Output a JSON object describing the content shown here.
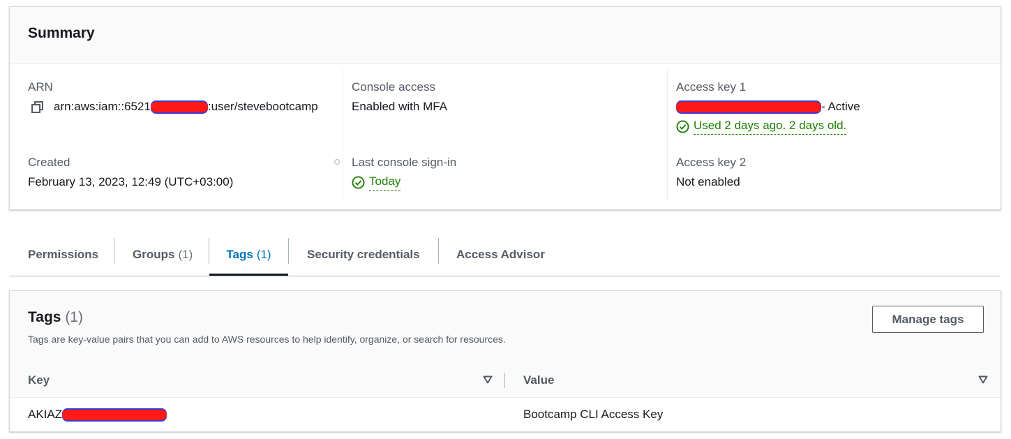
{
  "summary": {
    "title": "Summary",
    "arn_label": "ARN",
    "arn_prefix": "arn:aws:iam::6521",
    "arn_suffix": ":user/stevebootcamp",
    "created_label": "Created",
    "created_value": "February 13, 2023, 12:49 (UTC+03:00)",
    "console_access_label": "Console access",
    "console_access_value": "Enabled with MFA",
    "last_signin_label": "Last console sign-in",
    "last_signin_value": "Today",
    "access_key1_label": "Access key 1",
    "access_key1_status": "- Active",
    "access_key1_usage": "Used 2 days ago. 2 days old.",
    "access_key2_label": "Access key 2",
    "access_key2_value": "Not enabled"
  },
  "tabs": [
    {
      "label": "Permissions",
      "count": ""
    },
    {
      "label": "Groups",
      "count": "(1)"
    },
    {
      "label": "Tags",
      "count": "(1)"
    },
    {
      "label": "Security credentials",
      "count": ""
    },
    {
      "label": "Access Advisor",
      "count": ""
    }
  ],
  "tags_panel": {
    "title": "Tags",
    "count": "(1)",
    "description": "Tags are key-value pairs that you can add to AWS resources to help identify, organize, or search for resources.",
    "manage_button": "Manage tags",
    "columns": [
      "Key",
      "Value"
    ],
    "rows": [
      {
        "key_prefix": "AKIAZ",
        "value": "Bootcamp CLI Access Key"
      }
    ]
  },
  "colors": {
    "success": "#1d8102",
    "active_tab": "#0073bb",
    "redaction": "#ff1a1a"
  },
  "icons": [
    "copy-icon",
    "check-circle-icon",
    "sort-down-icon"
  ]
}
